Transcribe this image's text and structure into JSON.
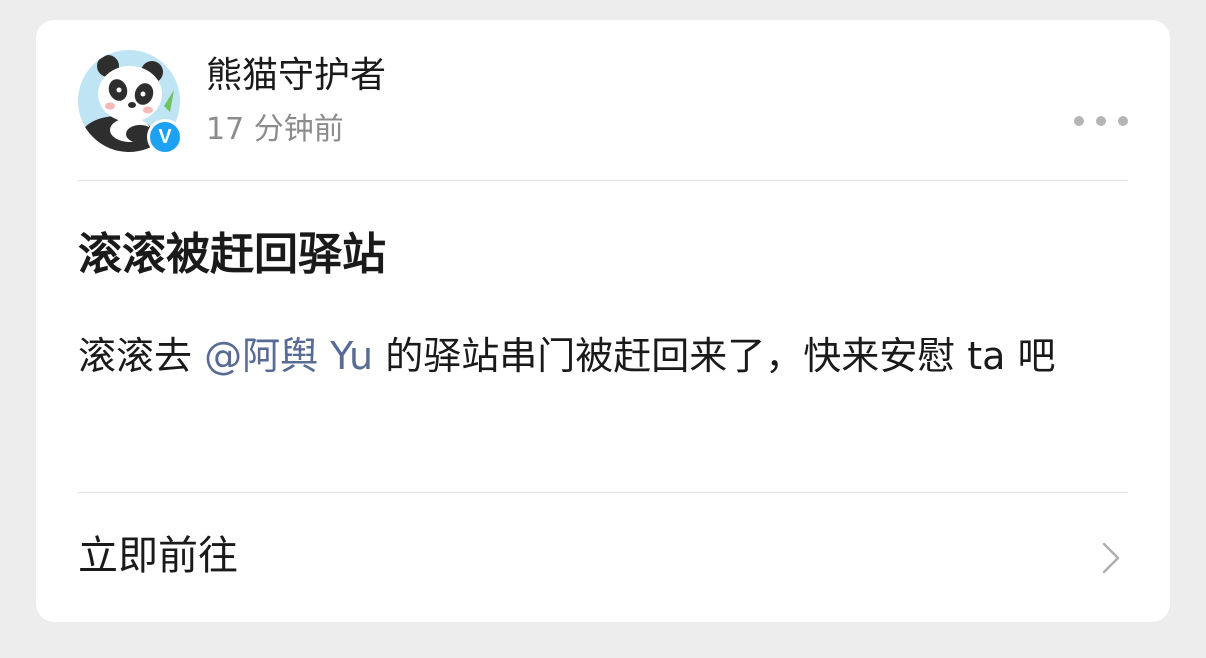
{
  "post": {
    "author": {
      "name": "熊猫守护者",
      "verified_mark": "V",
      "avatar_icon": "panda-avatar"
    },
    "time": "17 分钟前",
    "more_icon": "more-dots-icon",
    "title": "滚滚被赶回驿站",
    "body": {
      "before": "滚滚去 ",
      "mention": "@阿舆 Yu",
      "after": " 的驿站串门被赶回来了，快来安慰 ta 吧"
    },
    "action": {
      "label": "立即前往",
      "icon": "chevron-right-icon"
    }
  },
  "colors": {
    "mention": "#576b95",
    "verified": "#1da1f2",
    "background": "#ededed",
    "card": "#ffffff"
  }
}
